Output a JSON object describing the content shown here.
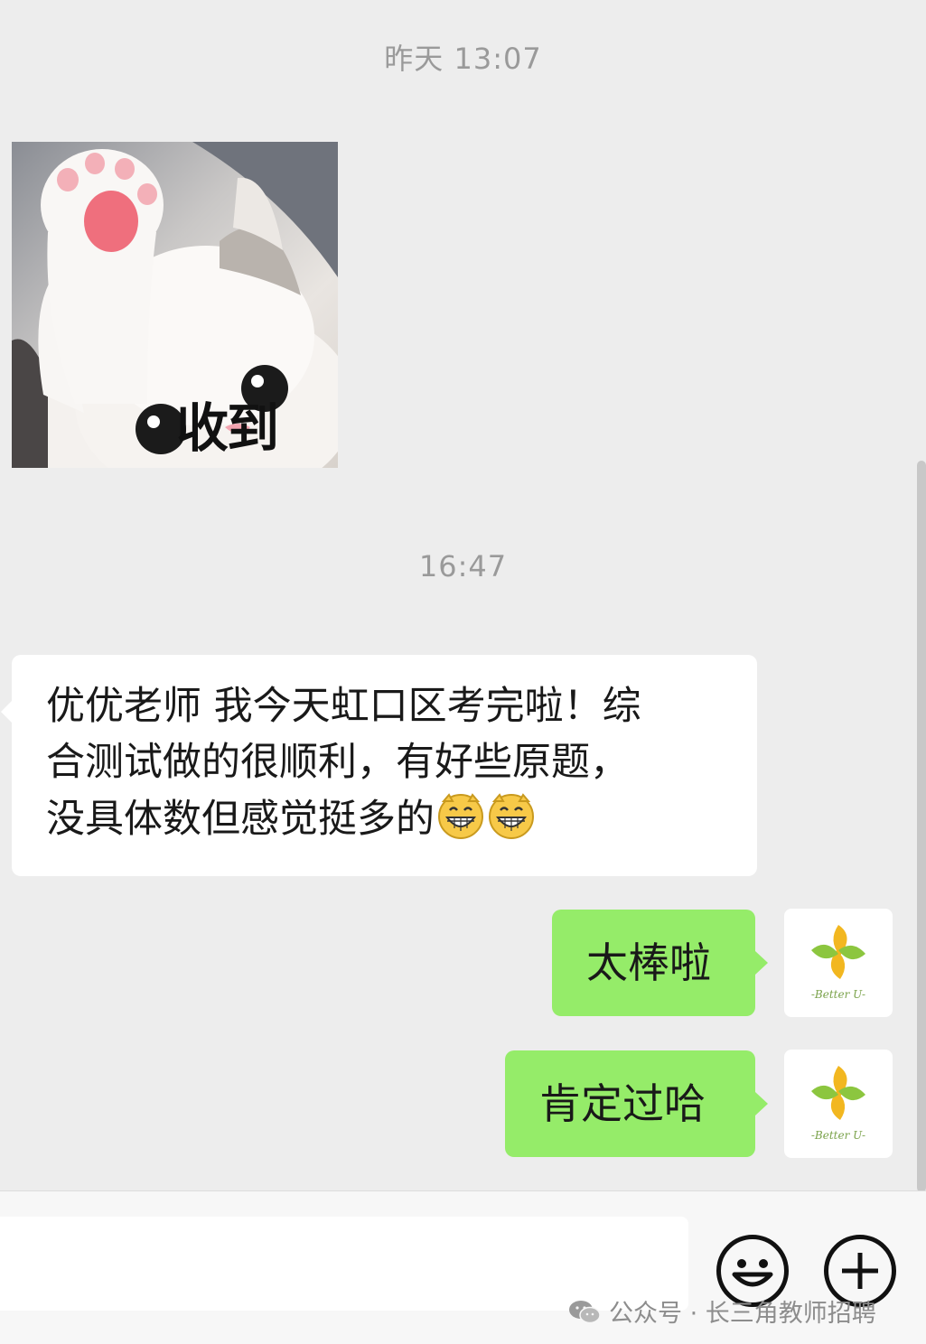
{
  "timestamps": {
    "first": "昨天 13:07",
    "second": "16:47"
  },
  "sticker": {
    "caption": "收到",
    "icon": "waving-cat-sticker"
  },
  "incoming_message": {
    "lines": [
      "优优老师 我今天虹口区考完啦！综",
      "合测试做的很顺利，有好些原题，",
      "没具体数但感觉挺多的"
    ],
    "emoji": "grin-emoji"
  },
  "outgoing_messages": [
    {
      "text": "太棒啦"
    },
    {
      "text": "肯定过哈"
    }
  ],
  "avatar": {
    "label": "-Better U-",
    "icon": "better-u-logo"
  },
  "input_bar": {
    "value": "",
    "emoji_button": "smiley-icon",
    "plus_button": "plus-icon"
  },
  "watermark": {
    "text": "公众号 · 长三角教师招聘",
    "icon": "wechat-icon"
  },
  "colors": {
    "background": "#ededed",
    "incoming_bubble": "#ffffff",
    "outgoing_bubble": "#95ec69",
    "timestamp": "#9a9a9a"
  }
}
